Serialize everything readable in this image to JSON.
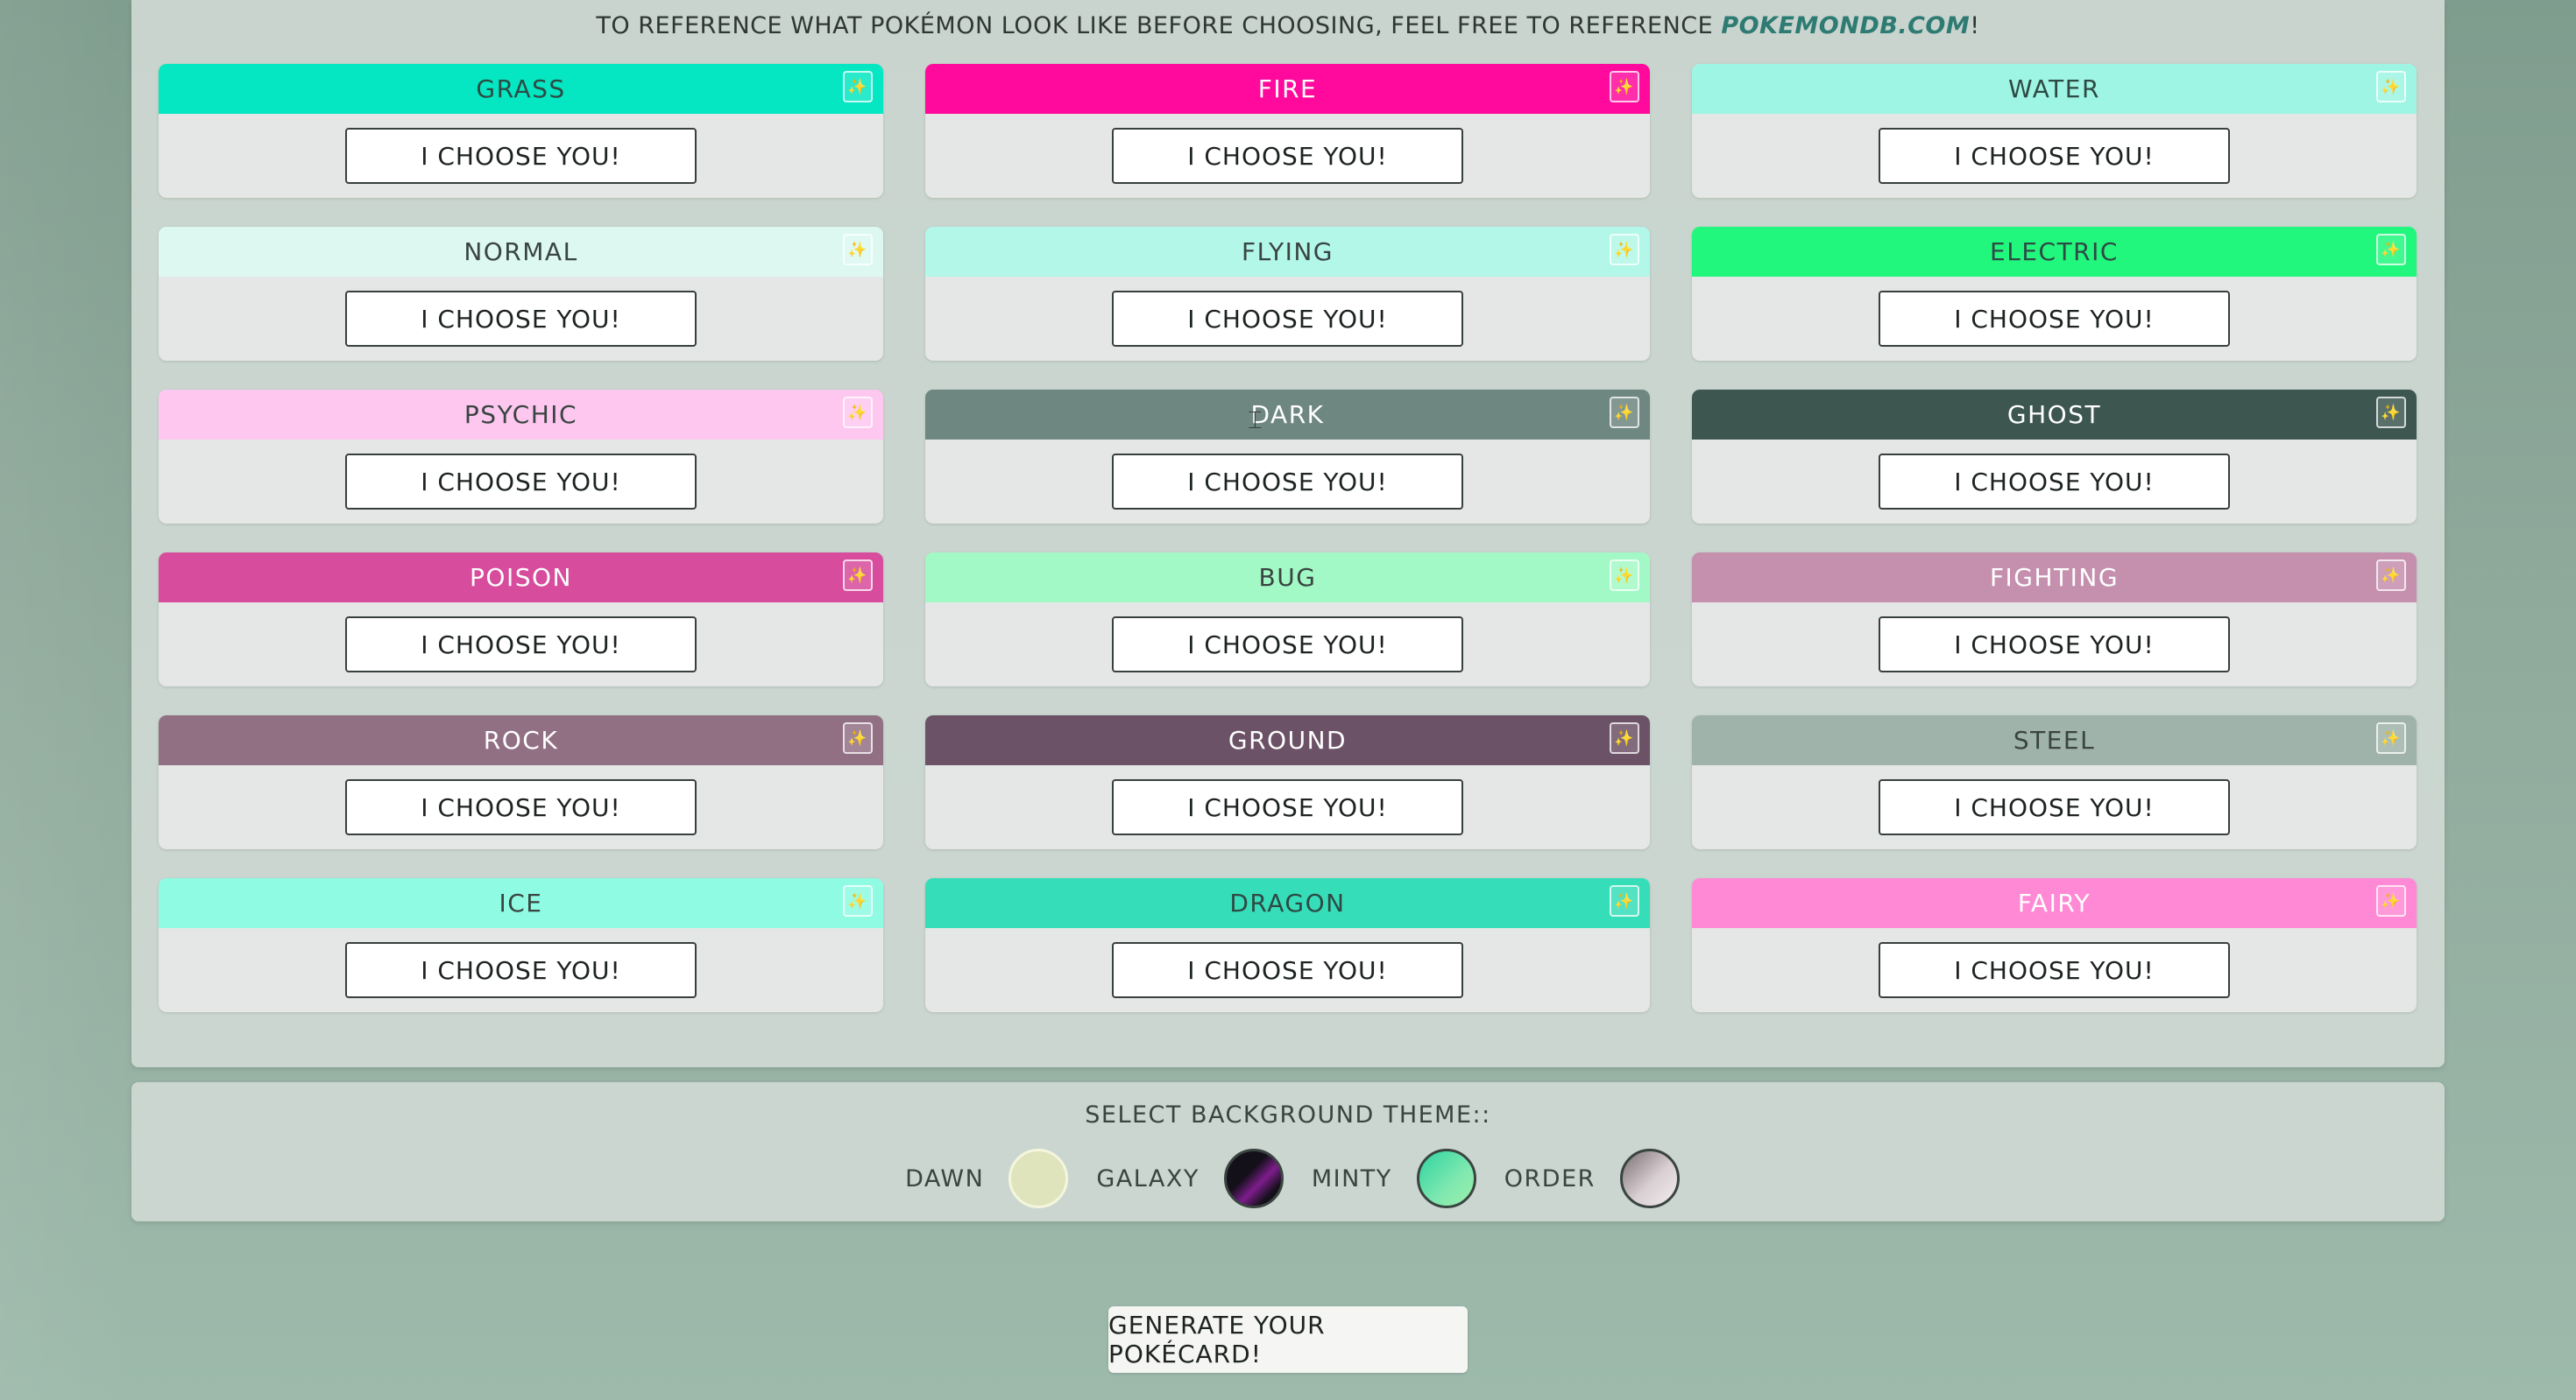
{
  "reference": {
    "text": "TO REFERENCE WHAT POKÉMON LOOK LIKE BEFORE CHOOSING, FEEL FREE TO REFERENCE ",
    "link": "POKEMONDB.COM",
    "suffix": "!"
  },
  "types": [
    {
      "name": "GRASS",
      "color": "#04e7c2",
      "text_color": "#2e4a44",
      "button": "I CHOOSE YOU!"
    },
    {
      "name": "FIRE",
      "color": "#ff0a9c",
      "text_color": "#ffffff",
      "button": "I CHOOSE YOU!"
    },
    {
      "name": "WATER",
      "color": "#9ef5e3",
      "text_color": "#2e4a44",
      "button": "I CHOOSE YOU!"
    },
    {
      "name": "NORMAL",
      "color": "#dcf8f1",
      "text_color": "#3a4440",
      "button": "I CHOOSE YOU!"
    },
    {
      "name": "FLYING",
      "color": "#b2f7e8",
      "text_color": "#3a4440",
      "button": "I CHOOSE YOU!"
    },
    {
      "name": "ELECTRIC",
      "color": "#22f77d",
      "text_color": "#2e4a44",
      "button": "I CHOOSE YOU!"
    },
    {
      "name": "PSYCHIC",
      "color": "#fdc7f0",
      "text_color": "#3a4440",
      "button": "I CHOOSE YOU!"
    },
    {
      "name": "DARK",
      "color": "#6e8780",
      "text_color": "#ffffff",
      "button": "I CHOOSE YOU!"
    },
    {
      "name": "GHOST",
      "color": "#3d5650",
      "text_color": "#ffffff",
      "button": "I CHOOSE YOU!"
    },
    {
      "name": "POISON",
      "color": "#d74c9d",
      "text_color": "#ffffff",
      "button": "I CHOOSE YOU!"
    },
    {
      "name": "BUG",
      "color": "#a3f9c6",
      "text_color": "#3a4440",
      "button": "I CHOOSE YOU!"
    },
    {
      "name": "FIGHTING",
      "color": "#c58fae",
      "text_color": "#ffffff",
      "button": "I CHOOSE YOU!"
    },
    {
      "name": "ROCK",
      "color": "#927084",
      "text_color": "#ffffff",
      "button": "I CHOOSE YOU!"
    },
    {
      "name": "GROUND",
      "color": "#6c5266",
      "text_color": "#ffffff",
      "button": "I CHOOSE YOU!"
    },
    {
      "name": "STEEL",
      "color": "#9fb3ab",
      "text_color": "#3a4440",
      "button": "I CHOOSE YOU!"
    },
    {
      "name": "ICE",
      "color": "#8efbe2",
      "text_color": "#3a4440",
      "button": "I CHOOSE YOU!"
    },
    {
      "name": "DRAGON",
      "color": "#36ddb9",
      "text_color": "#2e4a44",
      "button": "I CHOOSE YOU!"
    },
    {
      "name": "FAIRY",
      "color": "#ff89d4",
      "text_color": "#ffffff",
      "button": "I CHOOSE YOU!"
    }
  ],
  "sparkle_icon": "✨",
  "theme": {
    "title": "SELECT BACKGROUND THEME::",
    "options": [
      {
        "label": "DAWN",
        "icon": "swatch-dawn"
      },
      {
        "label": "GALAXY",
        "icon": "swatch-galaxy"
      },
      {
        "label": "MINTY",
        "icon": "swatch-minty"
      },
      {
        "label": "ORDER",
        "icon": "swatch-order"
      }
    ]
  },
  "generate_button": "GENERATE YOUR POKÉCARD!"
}
